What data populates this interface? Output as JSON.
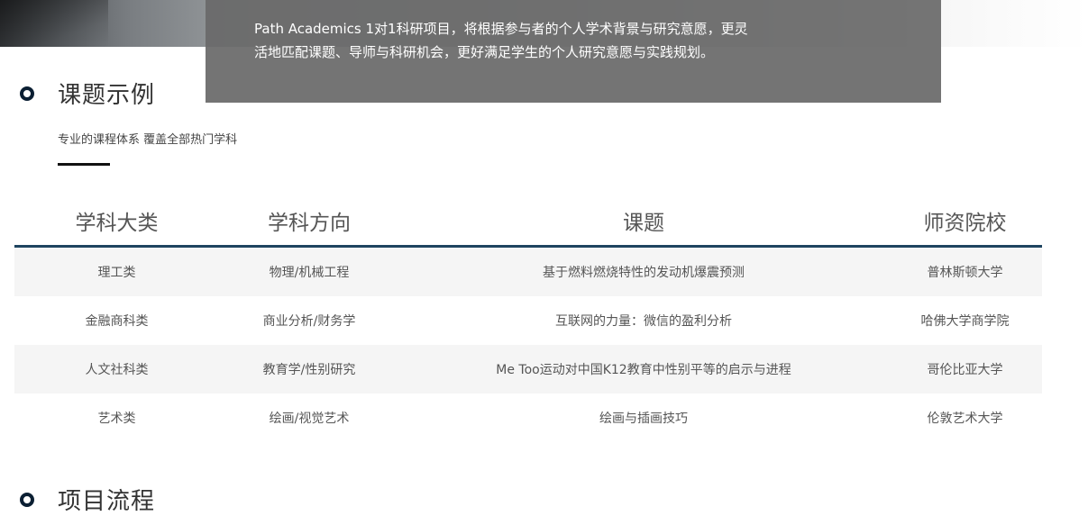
{
  "hero": {
    "line1": "Path Academics 1对1科研项目，将根据参与者的个人学术背景与研究意愿，更灵",
    "line2": "活地匹配课题、导师与科研机会，更好满足学生的个人研究意愿与实践规划。"
  },
  "topics_section": {
    "title": "课题示例",
    "subtitle": "专业的课程体系 覆盖全部热门学科"
  },
  "table": {
    "headers": [
      "学科大类",
      "学科方向",
      "课题",
      "师资院校"
    ],
    "rows": [
      [
        "理工类",
        "物理/机械工程",
        "基于燃料燃烧特性的发动机爆震预测",
        "普林斯顿大学"
      ],
      [
        "金融商科类",
        "商业分析/财务学",
        "互联网的力量：微信的盈利分析",
        "哈佛大学商学院"
      ],
      [
        "人文社科类",
        "教育学/性别研究",
        "Me Too运动对中国K12教育中性别平等的启示与进程",
        "哥伦比亚大学"
      ],
      [
        "艺术类",
        "绘画/视觉艺术",
        "绘画与插画技巧",
        "伦敦艺术大学"
      ]
    ]
  },
  "process_section": {
    "title": "项目流程"
  },
  "colors": {
    "accent": "#1e4460",
    "bullet": "#0b1f33",
    "panel": "#696969"
  }
}
